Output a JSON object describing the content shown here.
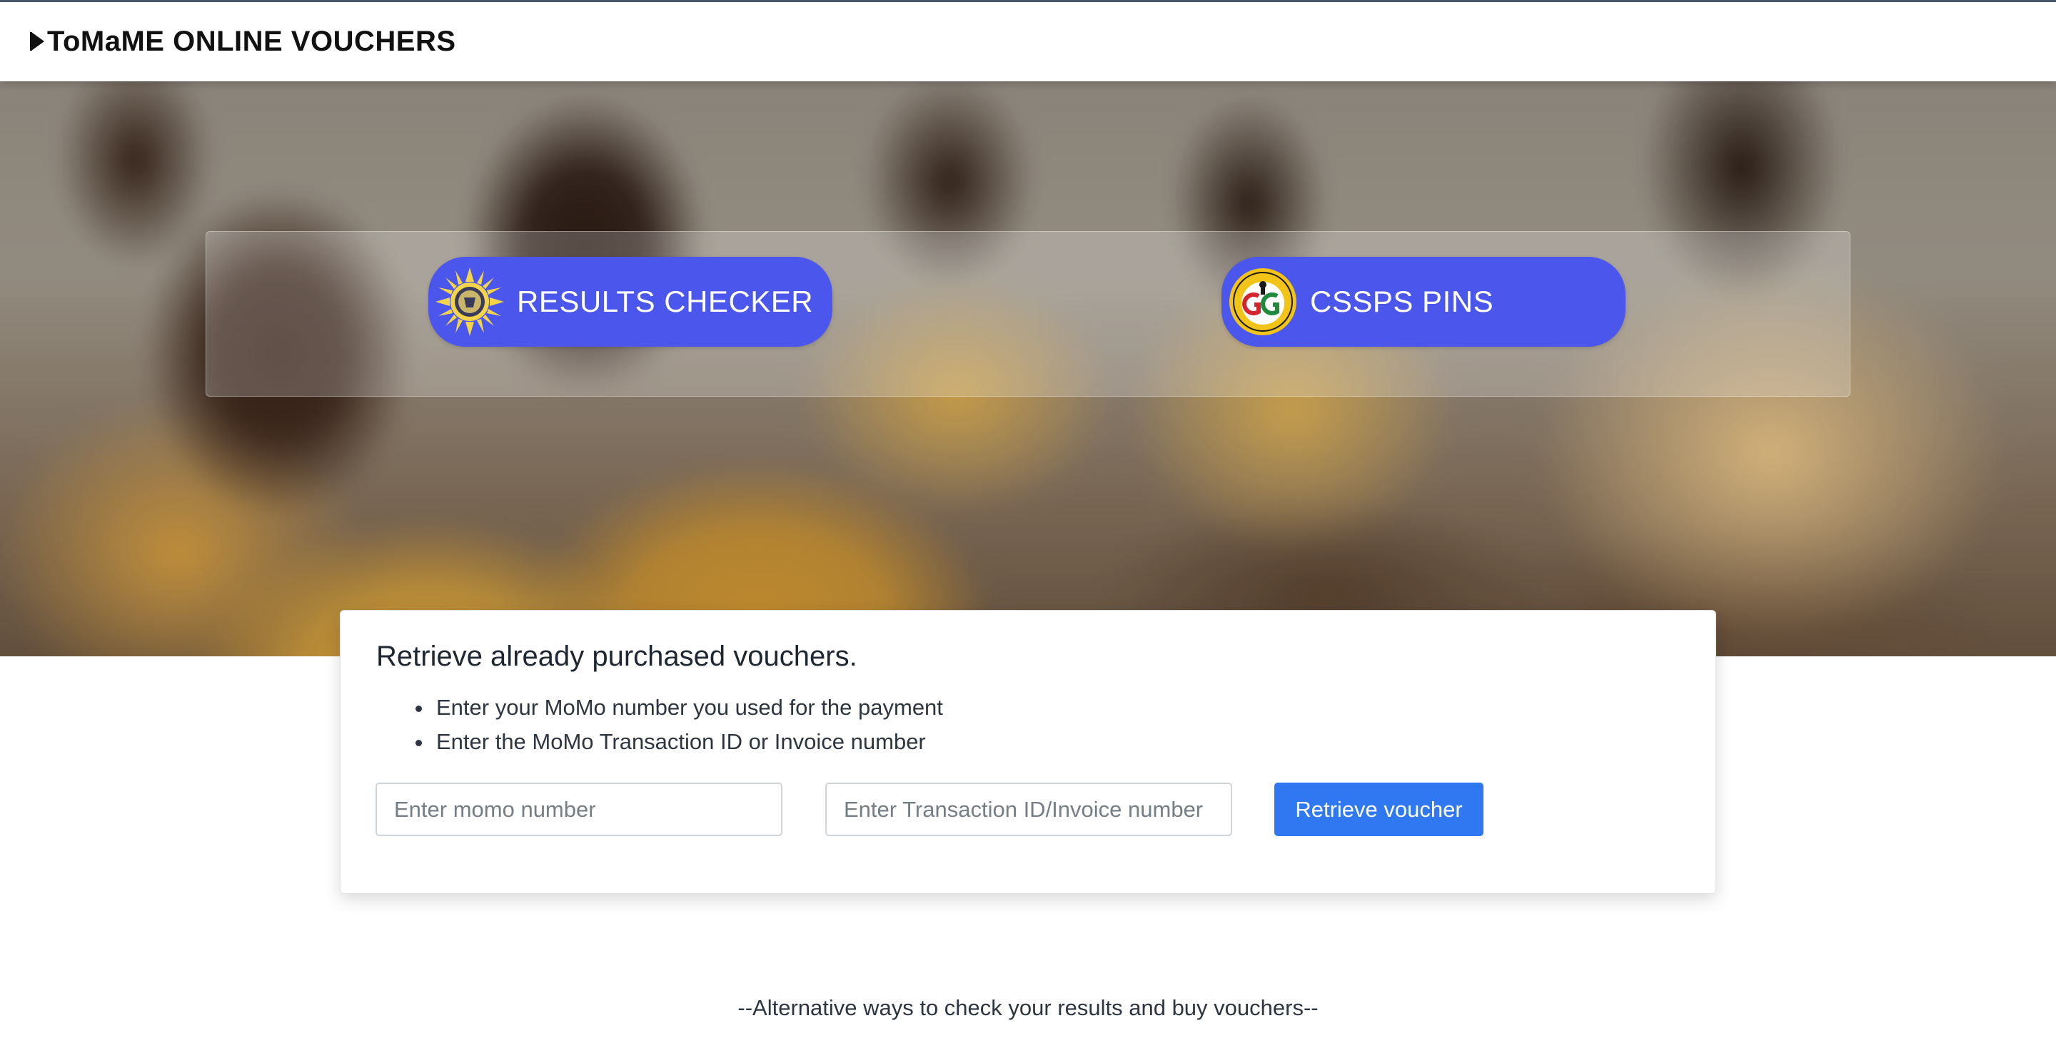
{
  "navbar": {
    "brand_text": "ToMaME ONLINE VOUCHERS",
    "brand_icon": "play-triangle-icon"
  },
  "hero": {
    "buttons": [
      {
        "label": "RESULTS CHECKER",
        "icon": "waec-seal-logo"
      },
      {
        "label": "CSSPS PINS",
        "icon": "ges-logo"
      }
    ]
  },
  "retrieve": {
    "title": "Retrieve already purchased vouchers.",
    "instructions": [
      "Enter your MoMo number you used for the payment",
      "Enter the MoMo Transaction ID or Invoice number"
    ],
    "momo_placeholder": "Enter momo number",
    "momo_value": "",
    "txn_placeholder": "Enter Transaction ID/Invoice number",
    "txn_value": "",
    "button_label": "Retrieve voucher"
  },
  "footer": {
    "alt_text": "--Alternative ways to check your results and buy vouchers--"
  },
  "colors": {
    "cta_button": "#4a56ec",
    "retrieve_button": "#2f78f1",
    "navbar_border": "#4a5568"
  }
}
